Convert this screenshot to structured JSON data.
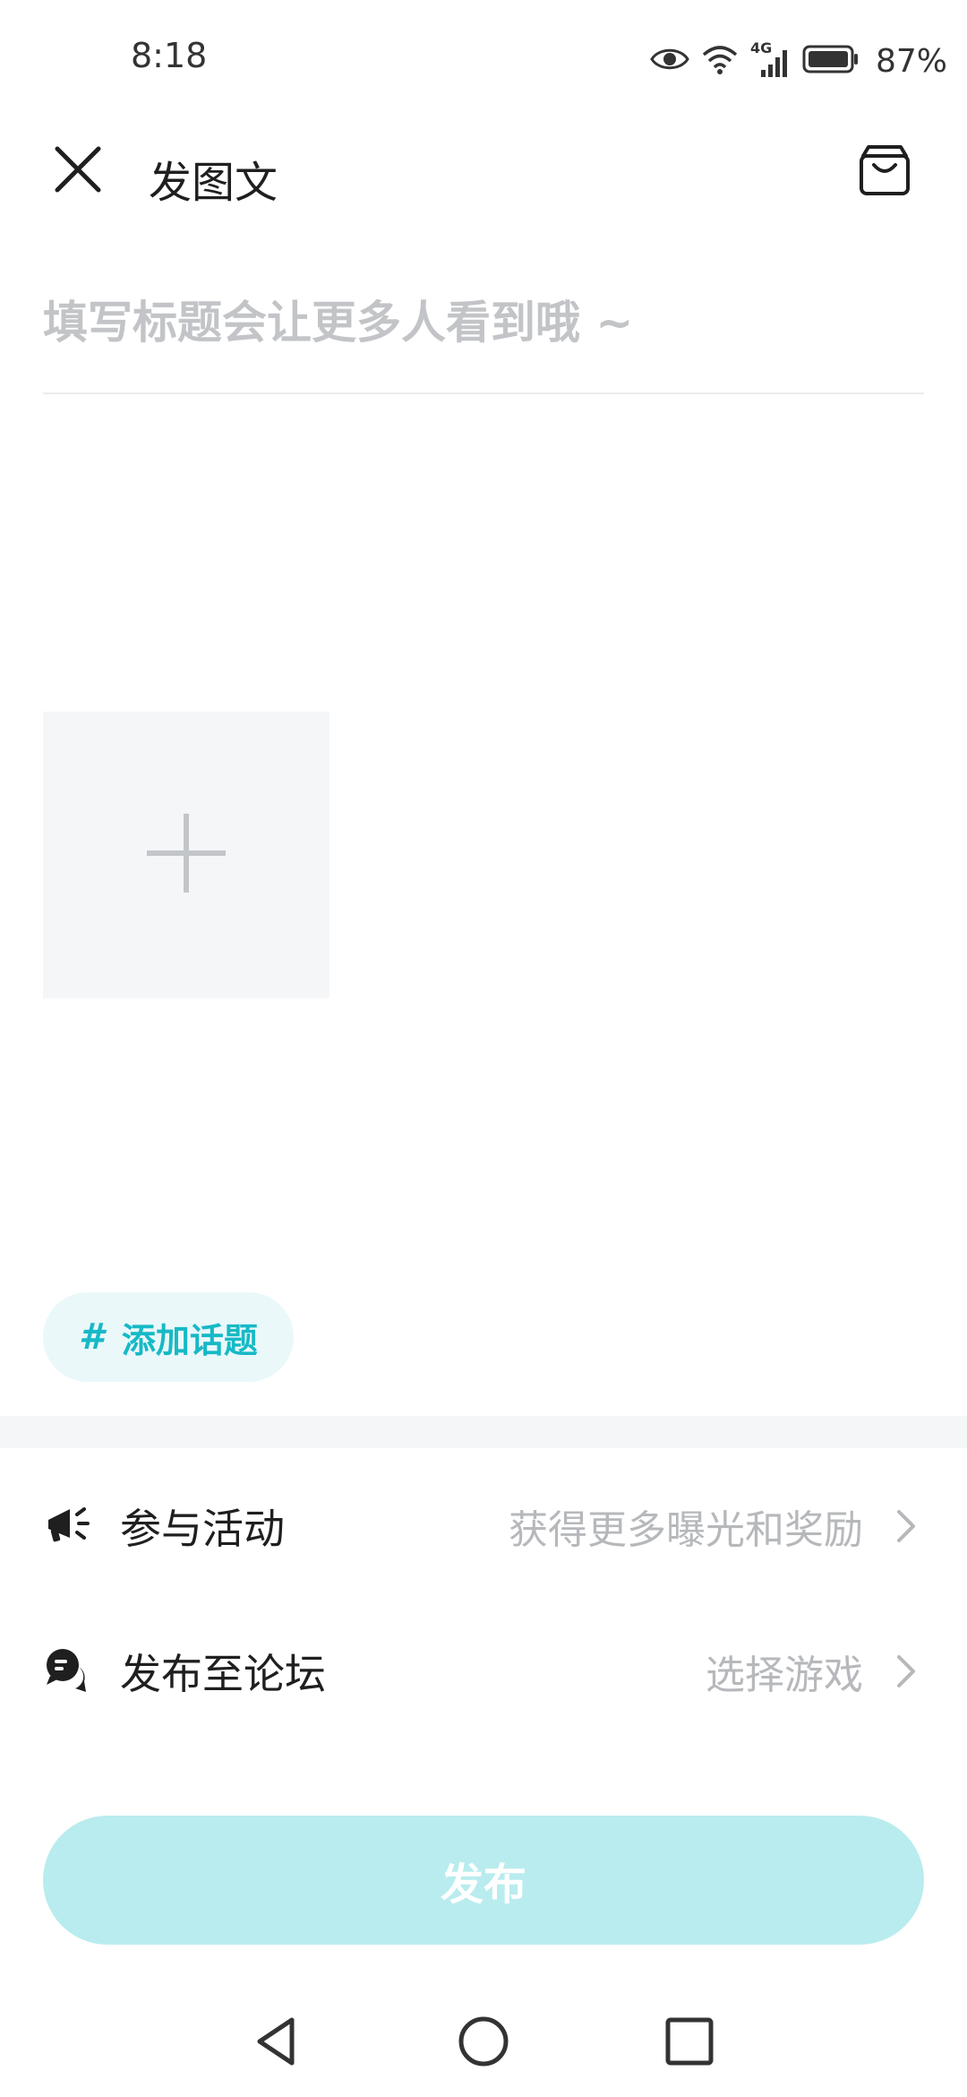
{
  "status_bar": {
    "time": "8:18",
    "network": "4G",
    "battery": "87%"
  },
  "header": {
    "title": "发图文"
  },
  "title_input": {
    "placeholder": "填写标题会让更多人看到哦 ~",
    "value": ""
  },
  "topic": {
    "hash": "#",
    "label": "添加话题"
  },
  "rows": {
    "activity": {
      "label": "参与活动",
      "value": "获得更多曝光和奖励"
    },
    "forum": {
      "label": "发布至论坛",
      "value": "选择游戏"
    }
  },
  "publish_button": {
    "label": "发布"
  },
  "icons": {
    "close": "close-icon",
    "drafts": "drafts-box-icon",
    "add": "plus-icon",
    "activity": "megaphone-icon",
    "forum": "chat-bubbles-icon",
    "chevron": "chevron-right-icon"
  },
  "colors": {
    "accent": "#17b9c6",
    "publish_disabled": "#b9ecee",
    "chip_bg": "#eaf8fa",
    "placeholder": "#c2c4c7"
  }
}
